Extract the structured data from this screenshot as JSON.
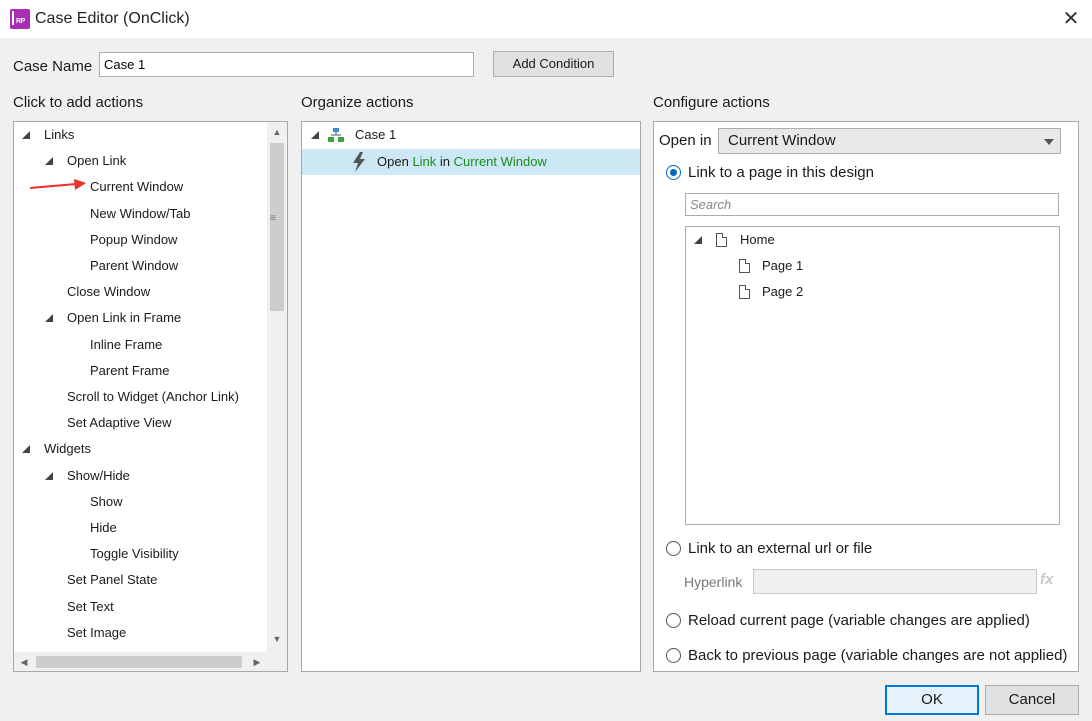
{
  "window": {
    "title": "Case Editor (OnClick)",
    "icon_text": "RP",
    "icon_color": "#a92eb5",
    "close_glyph": "✕"
  },
  "case_name": {
    "label": "Case Name",
    "value": "Case 1",
    "add_condition_label": "Add Condition"
  },
  "add_actions": {
    "header": "Click to add actions",
    "items": [
      {
        "label": "Links",
        "level": 0,
        "expanded": true
      },
      {
        "label": "Open Link",
        "level": 1,
        "expanded": true
      },
      {
        "label": "Current Window",
        "level": 2
      },
      {
        "label": "New Window/Tab",
        "level": 2
      },
      {
        "label": "Popup Window",
        "level": 2
      },
      {
        "label": "Parent Window",
        "level": 2
      },
      {
        "label": "Close Window",
        "level": 1
      },
      {
        "label": "Open Link in Frame",
        "level": 1,
        "expanded": true
      },
      {
        "label": "Inline Frame",
        "level": 2
      },
      {
        "label": "Parent Frame",
        "level": 2
      },
      {
        "label": "Scroll to Widget (Anchor Link)",
        "level": 1
      },
      {
        "label": "Set Adaptive View",
        "level": 1
      },
      {
        "label": "Widgets",
        "level": 0,
        "expanded": true
      },
      {
        "label": "Show/Hide",
        "level": 1,
        "expanded": true
      },
      {
        "label": "Show",
        "level": 2
      },
      {
        "label": "Hide",
        "level": 2
      },
      {
        "label": "Toggle Visibility",
        "level": 2
      },
      {
        "label": "Set Panel State",
        "level": 1
      },
      {
        "label": "Set Text",
        "level": 1
      },
      {
        "label": "Set Image",
        "level": 1
      }
    ],
    "arrow_color": "#e8312a"
  },
  "organize_actions": {
    "header": "Organize actions",
    "case_label": "Case 1",
    "action": {
      "verb": "Open",
      "object": "Link",
      "preposition": "in",
      "target": "Current Window"
    },
    "selection_color": "#cce8f4",
    "highlight_color": "#1a8a1a"
  },
  "configure_actions": {
    "header": "Configure actions",
    "open_in_label": "Open in",
    "open_in_value": "Current Window",
    "option_page": "Link to a page in this design",
    "search_placeholder": "Search",
    "pages": [
      {
        "label": "Home",
        "level": 0
      },
      {
        "label": "Page 1",
        "level": 1
      },
      {
        "label": "Page 2",
        "level": 1
      }
    ],
    "option_external": "Link to an external url or file",
    "hyperlink_label": "Hyperlink",
    "fx_label": "fx",
    "option_reload": "Reload current page (variable changes are applied)",
    "option_back": "Back to previous page (variable changes are not applied)"
  },
  "footer": {
    "ok_label": "OK",
    "cancel_label": "Cancel"
  }
}
